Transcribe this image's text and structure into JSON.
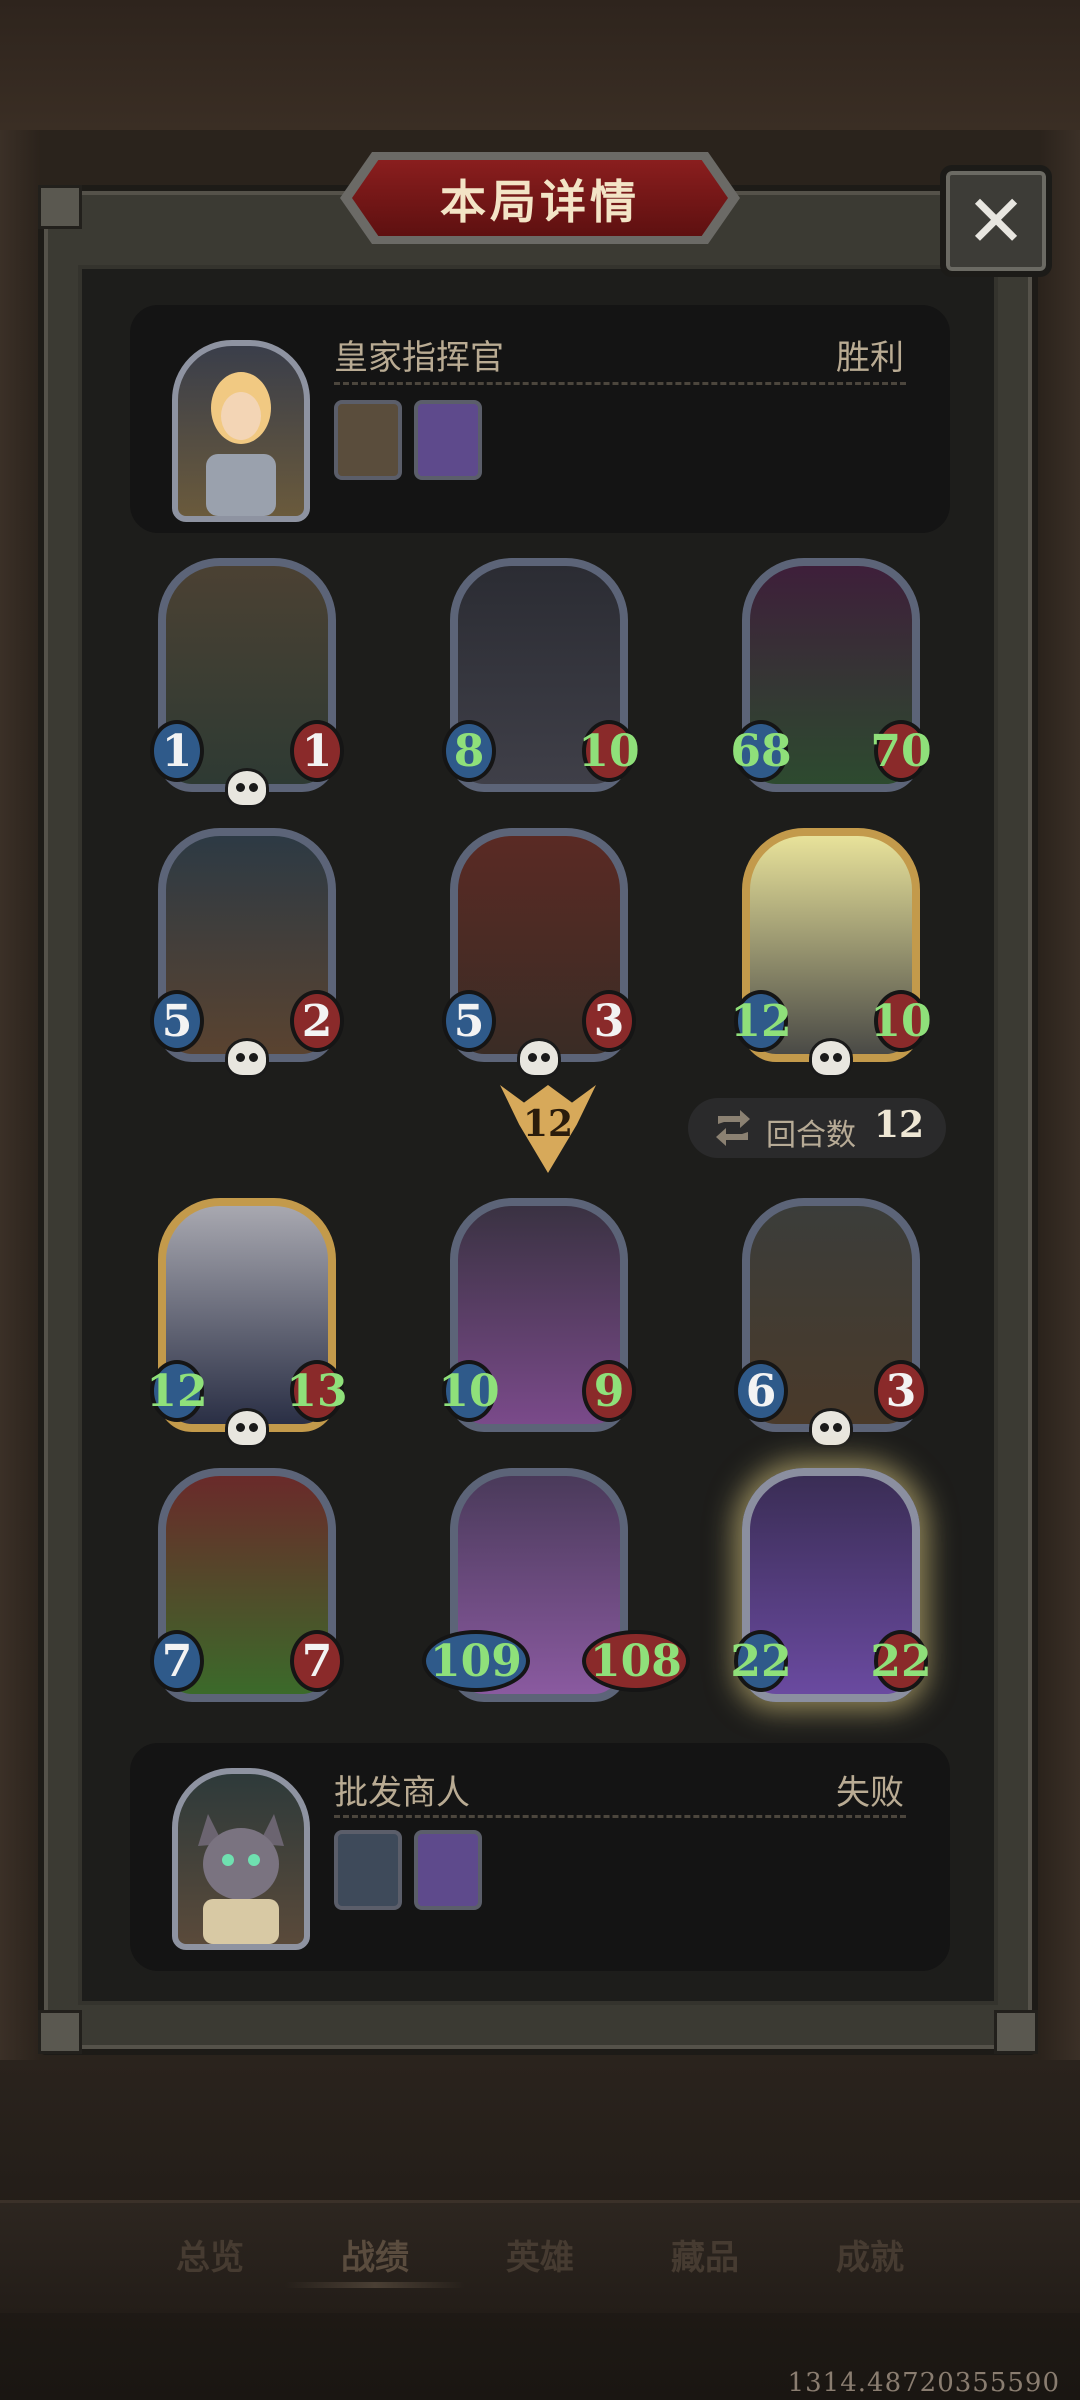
{
  "title": "本局详情",
  "close_icon": "close-icon",
  "top_player": {
    "name": "皇家指挥官",
    "result": "胜利"
  },
  "bottom_player": {
    "name": "批发商人",
    "result": "失败"
  },
  "round": {
    "label": "回合数",
    "value": "12",
    "icon": "swap-icon"
  },
  "vs_badge": "12",
  "top_board": [
    {
      "attack": "1",
      "health": "1",
      "skull": true
    },
    {
      "attack": "8",
      "health": "10",
      "skull": false
    },
    {
      "attack": "68",
      "health": "70",
      "skull": false
    },
    {
      "attack": "5",
      "health": "2",
      "skull": true
    },
    {
      "attack": "5",
      "health": "3",
      "skull": true
    },
    {
      "attack": "12",
      "health": "10",
      "skull": true
    }
  ],
  "bottom_board": [
    {
      "attack": "12",
      "health": "13",
      "skull": true
    },
    {
      "attack": "10",
      "health": "9",
      "skull": false
    },
    {
      "attack": "6",
      "health": "3",
      "skull": true
    },
    {
      "attack": "7",
      "health": "7",
      "skull": false
    },
    {
      "attack": "109",
      "health": "108",
      "skull": false
    },
    {
      "attack": "22",
      "health": "22",
      "skull": false
    }
  ],
  "tabs": [
    "总览",
    "战绩",
    "英雄",
    "藏品",
    "成就"
  ],
  "active_tab": "战绩",
  "version": "1314.48720355590",
  "colors": {
    "accent": "#c39a4b",
    "title_red": "#8a1e1e",
    "buff_green": "#8fe07a"
  }
}
